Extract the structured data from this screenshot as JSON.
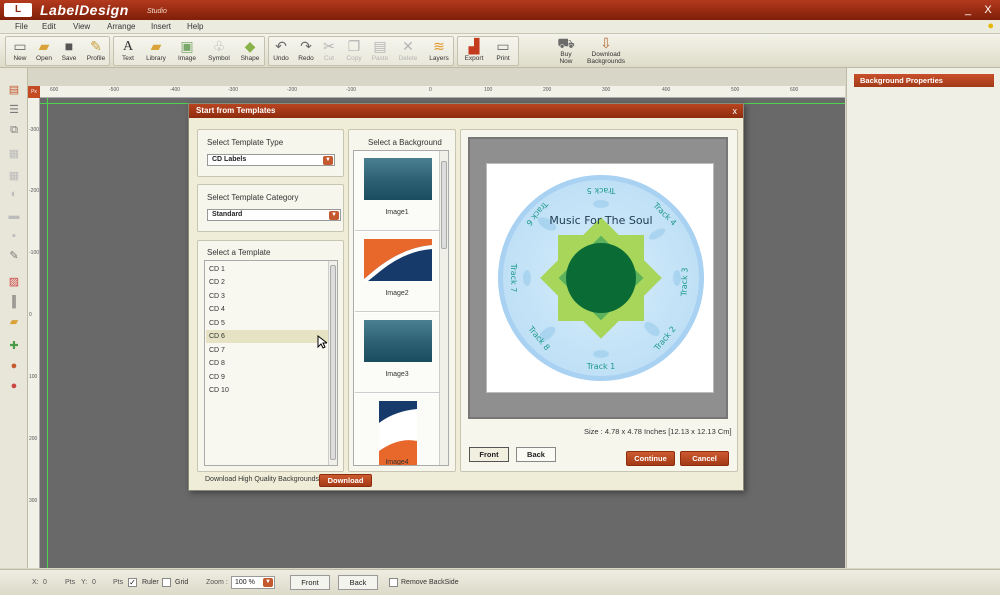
{
  "app": {
    "logo": "L",
    "title": "LabelDesign",
    "subtitle": "Studio",
    "minimize": "_",
    "close": "X"
  },
  "menu": [
    "File",
    "Edit",
    "View",
    "Arrange",
    "Insert",
    "Help"
  ],
  "toolbar": {
    "new": "New",
    "open": "Open",
    "save": "Save",
    "profile": "Profile",
    "text": "Text",
    "library": "Library",
    "image": "Image",
    "symbol": "Symbol",
    "shape": "Shape",
    "undo": "Undo",
    "redo": "Redo",
    "cut": "Cut",
    "copy": "Copy",
    "paste": "Paste",
    "delete": "Delete",
    "layers": "Layers",
    "export": "Export",
    "print": "Print",
    "buy_now_1": "Buy",
    "buy_now_2": "Now",
    "download_bg_1": "Download",
    "download_bg_2": "Backgrounds"
  },
  "icons": {
    "new": "new-icon",
    "open": "folder-icon",
    "save": "save-icon",
    "profile": "profile-icon",
    "text": "text-icon",
    "library": "library-icon",
    "image": "image-icon",
    "symbol": "symbol-icon",
    "shape": "shape-icon",
    "undo": "undo-icon",
    "redo": "redo-icon",
    "cut": "cut-icon",
    "copy": "copy-icon",
    "paste": "paste-icon",
    "delete": "delete-icon",
    "layers": "layers-icon",
    "export": "export-icon",
    "print": "print-icon",
    "buy": "cart-icon",
    "download": "download-icon",
    "bulb": "bulb-icon"
  },
  "ruler": {
    "unit": "Px",
    "h_ticks": [
      "600",
      "-500",
      "-400",
      "-300",
      "-200",
      "-100",
      "0",
      "100",
      "200",
      "300",
      "400",
      "500",
      "600"
    ],
    "v_ticks": [
      "-300",
      "-200",
      "-100",
      "0",
      "100",
      "200",
      "300"
    ]
  },
  "right_panel": {
    "title": "Background Properties"
  },
  "dialog": {
    "title": "Start from Templates",
    "close": "x",
    "type_label": "Select Template Type",
    "type_value": "CD Labels",
    "category_label": "Select Template Category",
    "category_value": "Standard",
    "template_label": "Select a Template",
    "templates": [
      "CD 1",
      "CD 2",
      "CD 3",
      "CD 4",
      "CD 5",
      "CD 6",
      "CD 7",
      "CD 8",
      "CD 9",
      "CD 10"
    ],
    "selected_template": "CD 6",
    "bg_label": "Select a Background",
    "backgrounds": [
      "Image1",
      "Image2",
      "Image3",
      "Image4"
    ],
    "preview": {
      "title": "Music For The Soul",
      "tracks": [
        "Track 1",
        "Track 2",
        "Track 3",
        "Track 4",
        "Track 5",
        "Track 6",
        "Track 7",
        "Track 8"
      ]
    },
    "size_text": "Size : 4.78 x 4.78 Inches [12.13 x 12.13 Cm]",
    "front": "Front",
    "back": "Back",
    "continue": "Continue",
    "cancel": "Cancel",
    "download_text": "Download High Quality Backgrounds",
    "download_btn": "Download"
  },
  "status": {
    "x_label": "X:",
    "x_value": "0",
    "x_unit": "Pts",
    "y_label": "Y:",
    "y_value": "0",
    "y_unit": "Pts",
    "ruler": "Ruler",
    "ruler_checked": "✓",
    "grid": "Grid",
    "zoom_label": "Zoom :",
    "zoom_value": "100 %",
    "front": "Front",
    "back": "Back",
    "remove_backside": "Remove BackSide"
  }
}
